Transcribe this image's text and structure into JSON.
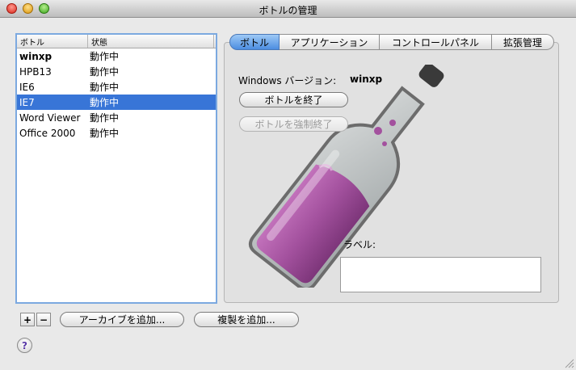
{
  "window": {
    "title": "ボトルの管理"
  },
  "list": {
    "columns": {
      "name": "ボトル",
      "status": "状態"
    },
    "rows": [
      {
        "name": "winxp",
        "status": "動作中"
      },
      {
        "name": "HPB13",
        "status": "動作中"
      },
      {
        "name": "IE6",
        "status": "動作中"
      },
      {
        "name": "IE7",
        "status": "動作中"
      },
      {
        "name": "Word Viewer",
        "status": "動作中"
      },
      {
        "name": "Office 2000",
        "status": "動作中"
      }
    ],
    "selected_index": 3,
    "bold_index": 0
  },
  "tabs": [
    "ボトル",
    "アプリケーション",
    "コントロールパネル",
    "拡張管理"
  ],
  "active_tab": 0,
  "bottle_tab": {
    "version_label": "Windows バージョン:",
    "version_value": "winxp",
    "stop_button": "ボトルを終了",
    "force_stop_button": "ボトルを強制終了",
    "label_caption": "ラベル:",
    "label_value": ""
  },
  "bottom": {
    "add_symbol": "+",
    "remove_symbol": "−",
    "add_archive": "アーカイブを追加...",
    "add_copy": "複製を追加...",
    "help_symbol": "?"
  },
  "icons": [
    "close-icon",
    "minimize-icon",
    "zoom-icon",
    "bottle-illustration",
    "help-icon",
    "resize-grip-icon"
  ],
  "colors": {
    "selection": "#3875d7",
    "tab_active": "#4c8de1",
    "wine": "#a3519e"
  }
}
